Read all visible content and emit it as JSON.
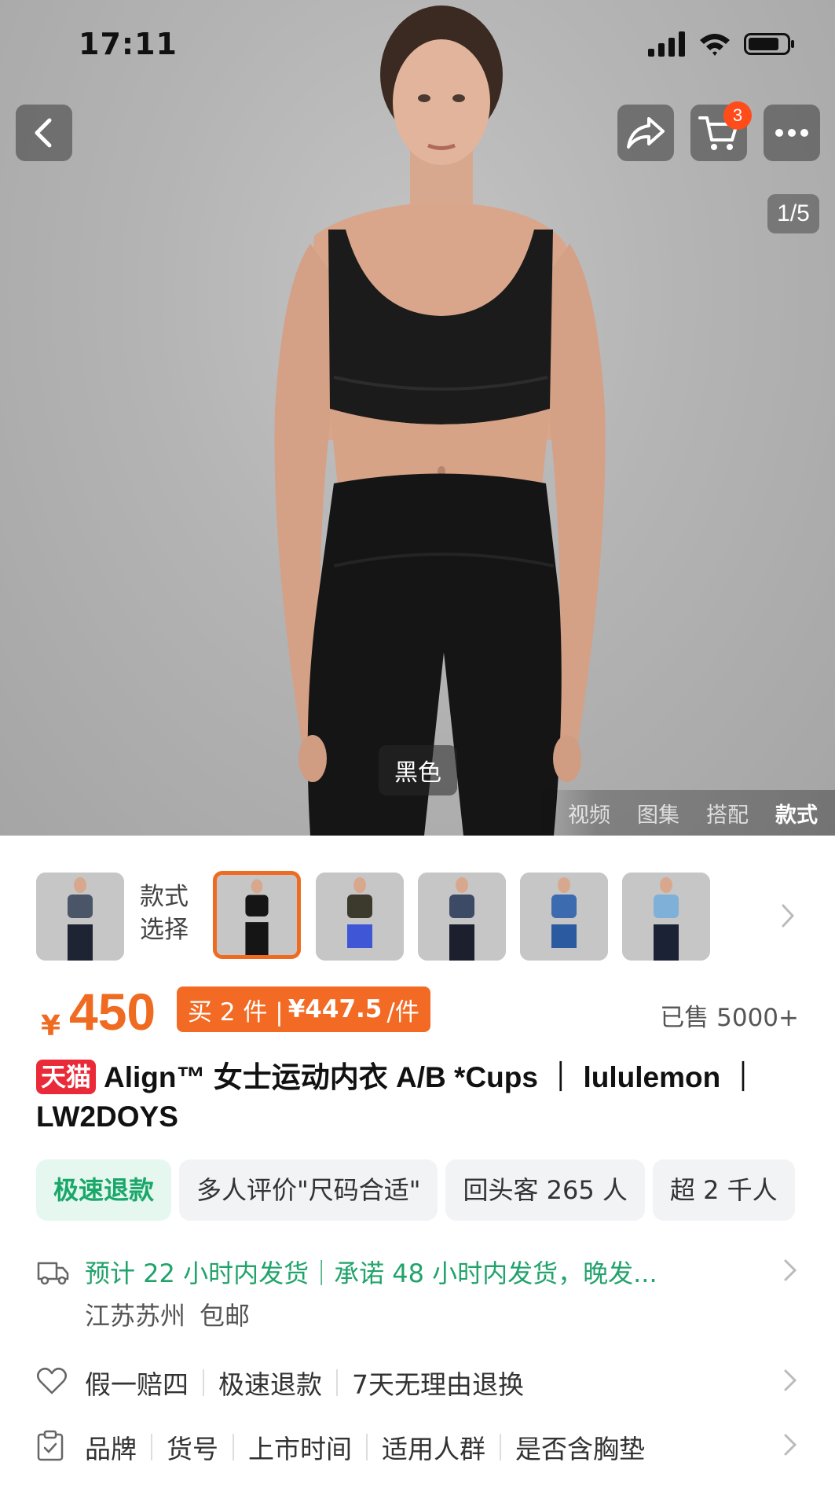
{
  "status_bar": {
    "time": "17:11"
  },
  "hero": {
    "cart_count": "3",
    "pager": "1/5",
    "color_tag": "黑色",
    "media_tabs": [
      {
        "label": "视频",
        "active": false
      },
      {
        "label": "图集",
        "active": false
      },
      {
        "label": "搭配",
        "active": false
      },
      {
        "label": "款式",
        "active": true
      }
    ]
  },
  "style_selector": {
    "label_line1": "款式",
    "label_line2": "选择",
    "thumbs": [
      {
        "top": "#4a5668",
        "bottom": "#1e2433"
      },
      {
        "top": "#151515",
        "bottom": "#151515",
        "selected": true
      },
      {
        "top": "#3b3a2c",
        "bottom": "#3f56d6"
      },
      {
        "top": "#3d4a66",
        "bottom": "#1b1f2e"
      },
      {
        "top": "#3c6bb0",
        "bottom": "#2c5aa0"
      },
      {
        "top": "#7fb1d8",
        "bottom": "#1b2236"
      }
    ]
  },
  "price": {
    "currency": "¥",
    "amount": "450",
    "promo_prefix": "买 2 件 |",
    "promo_price": "¥447.5",
    "promo_suffix": "/件",
    "sold": "已售 5000+"
  },
  "product": {
    "badge": "天猫",
    "title": "Align™ 女士运动内衣 A/B *Cups ｜ lululemon ｜ LW2DOYS"
  },
  "tags": [
    {
      "label": "极速退款",
      "highlight": true
    },
    {
      "label": "多人评价\"尺码合适\"",
      "highlight": false
    },
    {
      "label": "回头客 265 人",
      "highlight": false
    },
    {
      "label": "超 2 千人",
      "highlight": false
    }
  ],
  "shipping": {
    "main": "预计 22 小时内发货｜承诺 48 小时内发货，晚发...",
    "location": "江苏苏州",
    "free_shipping": "包邮"
  },
  "services": [
    "假一赔四",
    "极速退款",
    "7天无理由退换"
  ],
  "params": [
    "品牌",
    "货号",
    "上市时间",
    "适用人群",
    "是否含胸垫"
  ],
  "colors": {
    "accent": "#f06b22",
    "tmall": "#ea2a38",
    "green": "#1aa86a"
  }
}
